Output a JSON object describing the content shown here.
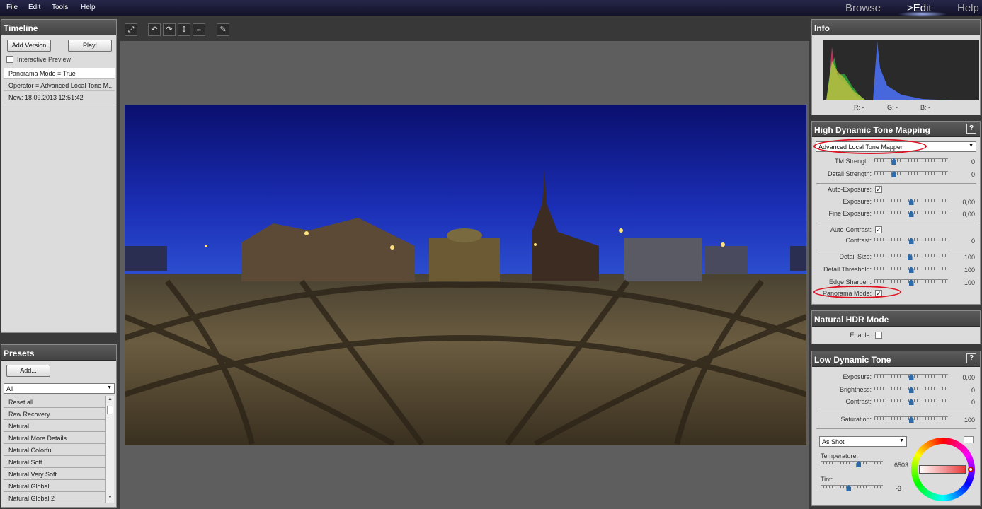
{
  "menu": [
    "File",
    "Edit",
    "Tools",
    "Help"
  ],
  "modes": {
    "browse": "Browse",
    "edit": ">Edit",
    "help": "Help"
  },
  "timeline": {
    "title": "Timeline",
    "add_version": "Add Version",
    "play": "Play!",
    "interactive_preview": "Interactive Preview",
    "entries": [
      "Panorama Mode = True",
      "Operator = Advanced Local Tone M...",
      "New: 18.09.2013 12:51:42"
    ]
  },
  "presets": {
    "title": "Presets",
    "add": "Add...",
    "filter": "All",
    "items": [
      "Reset all",
      "Raw Recovery",
      "Natural",
      "Natural More Details",
      "Natural Colorful",
      "Natural Soft",
      "Natural Very Soft",
      "Natural Global",
      "Natural Global 2"
    ]
  },
  "toolbar": {
    "icons": [
      "fit-view-icon",
      "rotate-left-icon",
      "rotate-right-icon",
      "flip-vertical-icon",
      "flip-horizontal-icon",
      "eyedropper-icon"
    ]
  },
  "info": {
    "title": "Info",
    "r": "R: -",
    "g": "G: -",
    "b": "B: -"
  },
  "hdtm": {
    "title": "High Dynamic Tone Mapping",
    "help": "?",
    "operator": "Advanced Local Tone Mapper",
    "tm_strength": {
      "label": "TM Strength:",
      "value": "0",
      "level": 0.25
    },
    "detail_strength": {
      "label": "Detail Strength:",
      "value": "0",
      "level": 0.25
    },
    "auto_exposure": {
      "label": "Auto-Exposure:",
      "checked": "✓"
    },
    "exposure": {
      "label": "Exposure:",
      "value": "0,00",
      "level": 0.5
    },
    "fine_exposure": {
      "label": "Fine Exposure:",
      "value": "0,00",
      "level": 0.5
    },
    "auto_contrast": {
      "label": "Auto-Contrast:",
      "checked": "✓"
    },
    "contrast": {
      "label": "Contrast:",
      "value": "0",
      "level": 0.5
    },
    "detail_size": {
      "label": "Detail Size:",
      "value": "100",
      "level": 0.48
    },
    "detail_threshold": {
      "label": "Detail Threshold:",
      "value": "100",
      "level": 0.5
    },
    "edge_sharpen": {
      "label": "Edge Sharpen:",
      "value": "100",
      "level": 0.5
    },
    "panorama_mode": {
      "label": "Panorama Mode:",
      "checked": "✓"
    }
  },
  "natural_hdr": {
    "title": "Natural HDR Mode",
    "enable": "Enable:"
  },
  "ldt": {
    "title": "Low Dynamic Tone",
    "help": "?",
    "exposure": {
      "label": "Exposure:",
      "value": "0,00",
      "level": 0.5
    },
    "brightness": {
      "label": "Brightness:",
      "value": "0",
      "level": 0.5
    },
    "contrast": {
      "label": "Contrast:",
      "value": "0",
      "level": 0.5
    },
    "saturation": {
      "label": "Saturation:",
      "value": "100",
      "level": 0.5
    },
    "white_balance": "As Shot",
    "temperature": {
      "label": "Temperature:",
      "value": "6503",
      "level": 0.62
    },
    "tint": {
      "label": "Tint:",
      "value": "-3",
      "level": 0.45
    }
  }
}
